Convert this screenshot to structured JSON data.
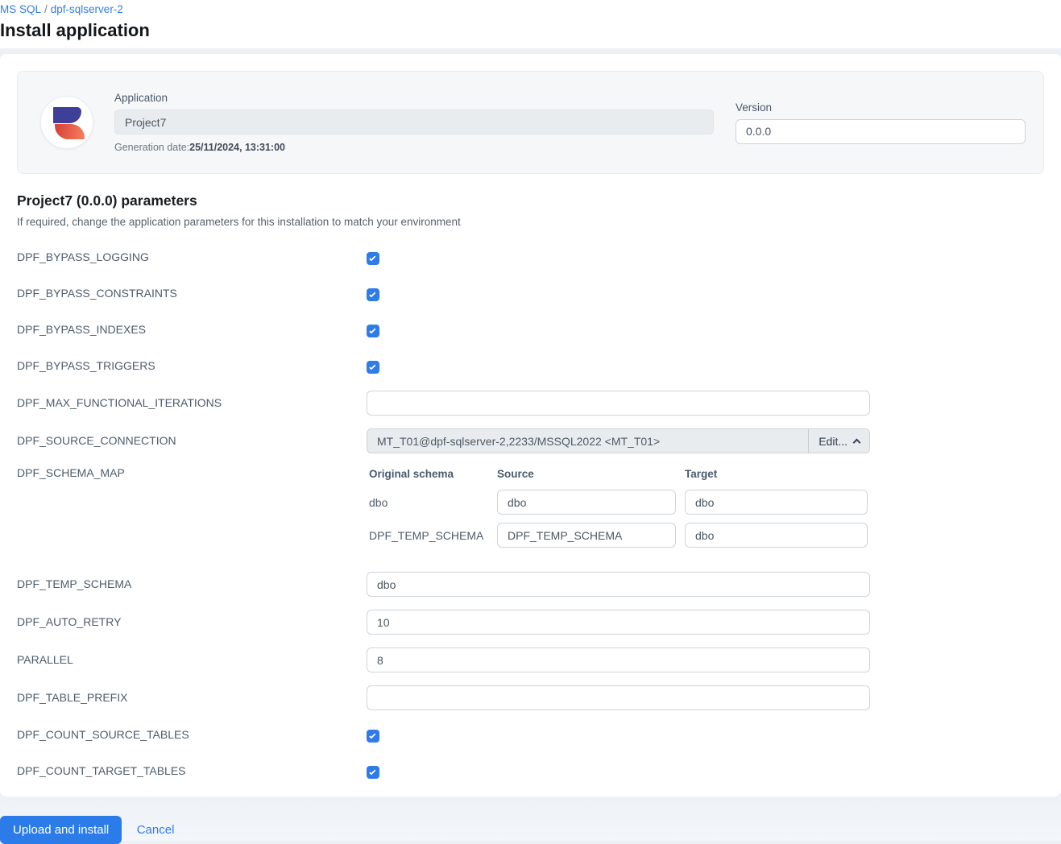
{
  "breadcrumb": {
    "items": [
      "MS SQL",
      "dpf-sqlserver-2"
    ],
    "separator": "/"
  },
  "page": {
    "title": "Install application"
  },
  "app_card": {
    "application_label": "Application",
    "application_value": "Project7",
    "generation_date_label": "Generation date:",
    "generation_date_value": "25/11/2024, 13:31:00",
    "version_label": "Version",
    "version_value": "0.0.0"
  },
  "params": {
    "heading": "Project7 (0.0.0) parameters",
    "subheading": "If required, change the application parameters for this installation to match your environment",
    "rows": [
      {
        "label": "DPF_BYPASS_LOGGING",
        "type": "checkbox",
        "checked": true
      },
      {
        "label": "DPF_BYPASS_CONSTRAINTS",
        "type": "checkbox",
        "checked": true
      },
      {
        "label": "DPF_BYPASS_INDEXES",
        "type": "checkbox",
        "checked": true
      },
      {
        "label": "DPF_BYPASS_TRIGGERS",
        "type": "checkbox",
        "checked": true
      },
      {
        "label": "DPF_MAX_FUNCTIONAL_ITERATIONS",
        "type": "text",
        "value": ""
      },
      {
        "label": "DPF_SOURCE_CONNECTION",
        "type": "connection"
      },
      {
        "label": "DPF_SCHEMA_MAP",
        "type": "schema-map"
      },
      {
        "label": "DPF_TEMP_SCHEMA",
        "type": "text",
        "value": "dbo"
      },
      {
        "label": "DPF_AUTO_RETRY",
        "type": "text",
        "value": "10"
      },
      {
        "label": "PARALLEL",
        "type": "text",
        "value": "8"
      },
      {
        "label": "DPF_TABLE_PREFIX",
        "type": "text",
        "value": ""
      },
      {
        "label": "DPF_COUNT_SOURCE_TABLES",
        "type": "checkbox",
        "checked": true
      },
      {
        "label": "DPF_COUNT_TARGET_TABLES",
        "type": "checkbox",
        "checked": true
      }
    ]
  },
  "source_connection": {
    "value": "MT_T01@dpf-sqlserver-2,2233/MSSQL2022 <MT_T01>",
    "edit_label": "Edit..."
  },
  "schema_map": {
    "headers": [
      "Original schema",
      "Source",
      "Target"
    ],
    "rows": [
      {
        "original": "dbo",
        "source": "dbo",
        "target": "dbo"
      },
      {
        "original": "DPF_TEMP_SCHEMA",
        "source": "DPF_TEMP_SCHEMA",
        "target": "dbo"
      }
    ]
  },
  "footer": {
    "submit_label": "Upload and install",
    "cancel_label": "Cancel"
  },
  "colors": {
    "accent_blue": "#2e7ce9",
    "link_blue": "#2f7ce8",
    "logo_indigo": "#3d3f99",
    "logo_red": "#e05243",
    "card_bg": "#f5f7f9",
    "readonly_bg": "#e9ecef",
    "page_bg": "#edf1f5"
  }
}
